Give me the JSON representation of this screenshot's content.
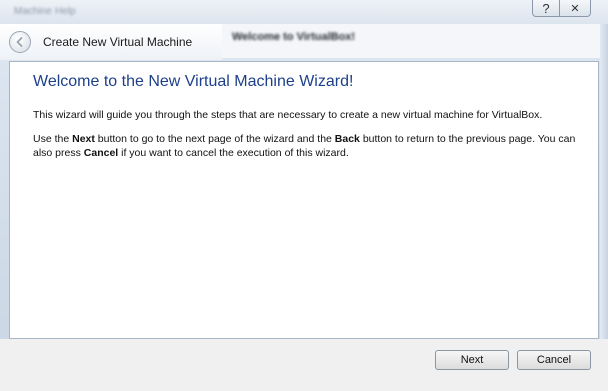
{
  "background_window": {
    "menu_items": [
      "Machine",
      "Help"
    ],
    "welcome_text": "Welcome to VirtualBox!"
  },
  "titlebar": {
    "help_glyph": "?",
    "close_glyph": "✕"
  },
  "dialog": {
    "title": "Create New Virtual Machine",
    "heading": "Welcome to the New Virtual Machine Wizard!",
    "paragraph1": "This wizard will guide you through the steps that are necessary to create a new virtual machine for VirtualBox.",
    "paragraph2": {
      "t1": "Use the ",
      "b1": "Next",
      "t2": " button to go to the next page of the wizard and the ",
      "b2": "Back",
      "t3": " button to return to the previous page. You can also press ",
      "b3": "Cancel",
      "t4": " if you want to cancel the execution of this wizard."
    }
  },
  "buttons": {
    "next": "Next",
    "cancel": "Cancel"
  },
  "icons": {
    "back": "back-arrow-icon",
    "help": "help-icon",
    "close": "close-icon"
  }
}
